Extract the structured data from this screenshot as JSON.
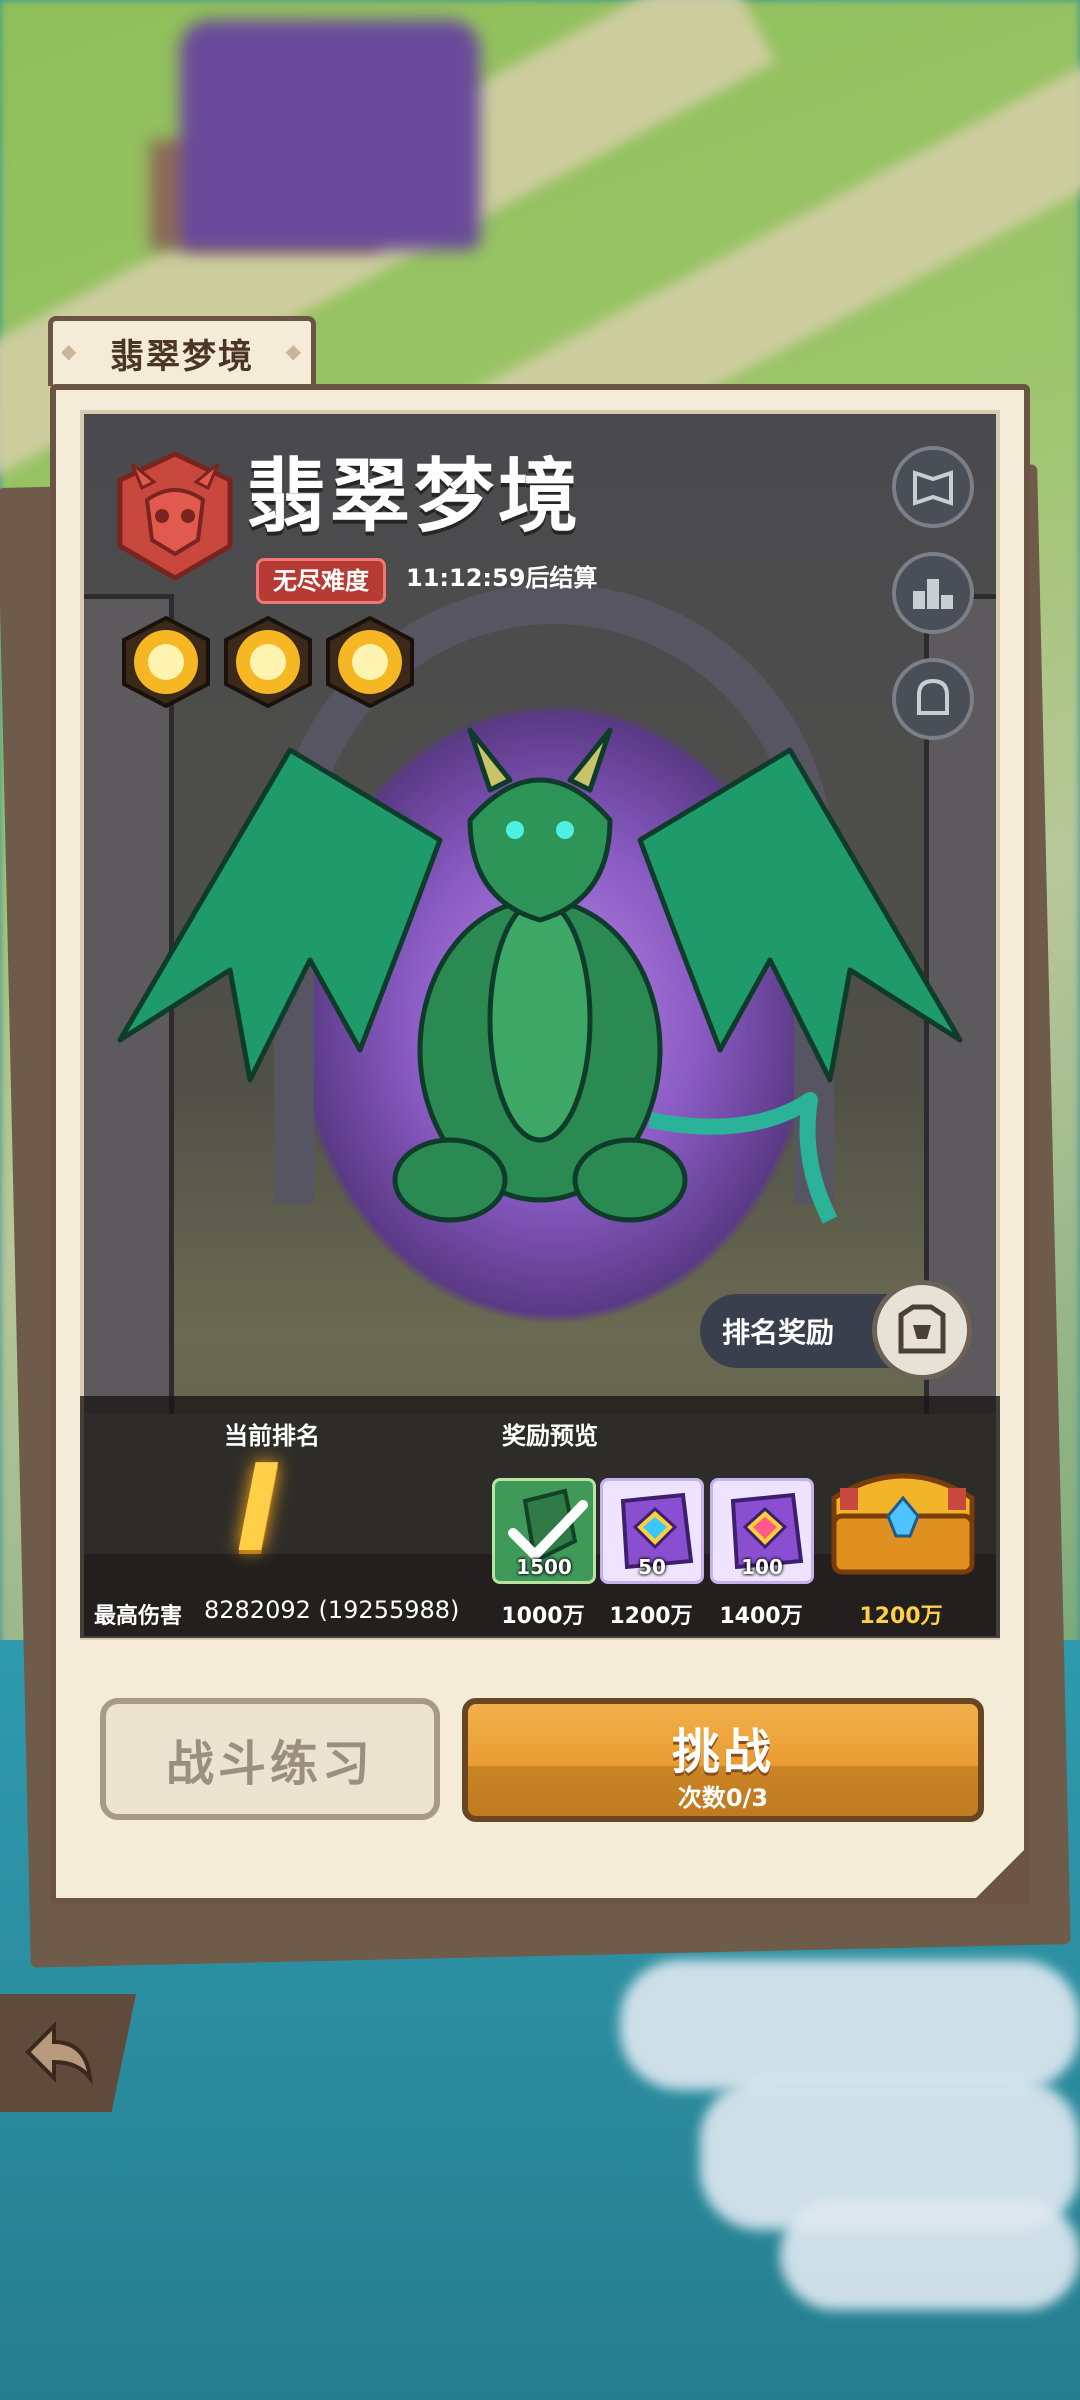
{
  "tab": {
    "label": "翡翠梦境"
  },
  "boss": {
    "title": "翡翠梦境",
    "difficulty": "无尽难度",
    "timer": "11:12:59后结算",
    "difficulty_color": "#b83a34"
  },
  "side_buttons": [
    {
      "icon": "monster-book-icon"
    },
    {
      "icon": "leaderboard-podium-icon"
    },
    {
      "icon": "helmet-profile-icon"
    }
  ],
  "rank_reward_button": {
    "label": "排名奖励",
    "icon": "trophy-frame-icon"
  },
  "ranking": {
    "current_rank_label": "当前排名",
    "current_rank": "I",
    "max_damage_label": "最高伤害",
    "max_damage_value": "8282092 (19255988)"
  },
  "reward_preview": {
    "label": "奖励预览",
    "items": [
      {
        "icon": "green-crystal-claimed-icon",
        "qty": "1500",
        "threshold": "1000万",
        "claimed": true
      },
      {
        "icon": "rainbow-gem-scroll-icon",
        "qty": "50",
        "threshold": "1200万",
        "claimed": false
      },
      {
        "icon": "rainbow-gem-scroll-icon",
        "qty": "100",
        "threshold": "1400万",
        "claimed": false
      },
      {
        "icon": "golden-treasure-chest-icon",
        "qty": "",
        "threshold": "1200万",
        "claimed": false
      }
    ]
  },
  "buttons": {
    "practice": "战斗练习",
    "challenge": "挑战",
    "challenge_count": "次数0/3"
  },
  "back": {
    "icon": "back-arrow-icon"
  },
  "colors": {
    "accent": "#e99c32",
    "rank_gold": "#ffcf47",
    "panel": "#f4ebd9"
  }
}
